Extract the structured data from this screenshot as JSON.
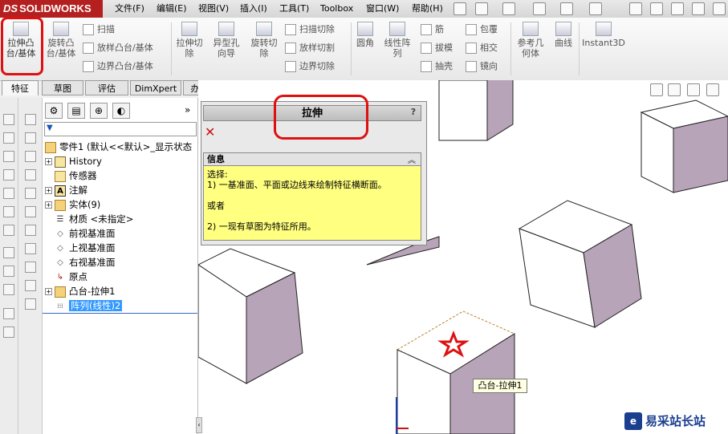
{
  "app": {
    "logo_text": "SOLIDWORKS",
    "logo_prefix": "DS"
  },
  "menu": [
    "文件(F)",
    "编辑(E)",
    "视图(V)",
    "插入(I)",
    "工具(T)",
    "Toolbox",
    "窗口(W)",
    "帮助(H)"
  ],
  "commands": {
    "extrude_boss": "拉伸凸台/基体",
    "revolve_boss": "旋转凸台/基体",
    "sweep": "扫描",
    "loft": "放样凸台/基体",
    "boundary_boss": "边界凸台/基体",
    "extrude_cut": "拉伸切除",
    "hole_wizard": "异型孔向导",
    "revolve_cut": "旋转切除",
    "swept_cut": "扫描切除",
    "lofted_cut": "放样切割",
    "boundary_cut": "边界切除",
    "fillet": "圆角",
    "linear_pattern": "线性阵列",
    "rib": "筋",
    "draft": "拔模",
    "shell": "抽壳",
    "wrap": "包覆",
    "intersect": "相交",
    "mirror": "镜向",
    "ref_geometry": "参考几何体",
    "curves": "曲线",
    "instant3d": "Instant3D"
  },
  "tabs": [
    "特征",
    "草图",
    "评估",
    "DimXpert",
    "办公室产品"
  ],
  "feature_tree": {
    "root": "零件1 (默认<<默认>_显示状态",
    "items": [
      {
        "label": "History",
        "expand": true
      },
      {
        "label": "传感器",
        "expand": false
      },
      {
        "label": "注解",
        "expand": true
      },
      {
        "label": "实体(9)",
        "expand": true
      },
      {
        "label": "材质 <未指定>",
        "expand": false
      },
      {
        "label": "前视基准面",
        "expand": false
      },
      {
        "label": "上视基准面",
        "expand": false
      },
      {
        "label": "右视基准面",
        "expand": false
      },
      {
        "label": "原点",
        "expand": false
      },
      {
        "label": "凸台-拉伸1",
        "expand": true
      },
      {
        "label": "阵列(线性)2",
        "expand": false,
        "selected": true
      }
    ]
  },
  "property_manager": {
    "title": "拉伸",
    "help": "?",
    "info_header": "信息",
    "info_lines": [
      "选择:",
      "1) 一基准面、平面或边线来绘制特征横断面。",
      "",
      "或者",
      "",
      "2) 一现有草图为特征所用。"
    ]
  },
  "tooltip": "凸台-拉伸1",
  "watermark": {
    "icon": "e",
    "text": "易采站长站"
  },
  "colors": {
    "logo_bg": "#b42020",
    "info_bg": "#ffff80",
    "selection": "#3399ff",
    "highlight": "#dd1111",
    "cube_side": "#b8a4b8"
  }
}
